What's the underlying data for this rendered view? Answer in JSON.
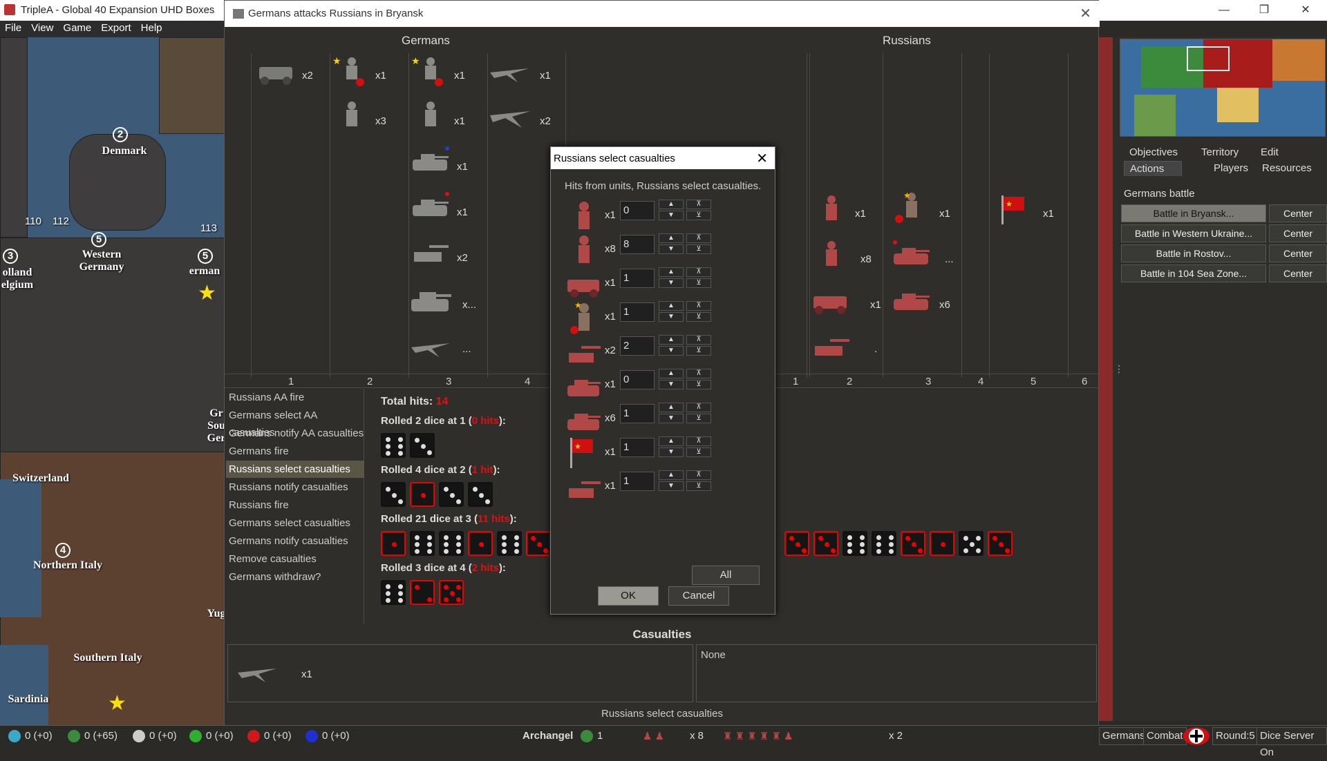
{
  "app": {
    "title": "TripleA - Global 40 Expansion UHD Boxes"
  },
  "menu": [
    {
      "label": "File"
    },
    {
      "label": "View"
    },
    {
      "label": "Game"
    },
    {
      "label": "Export"
    },
    {
      "label": "Help"
    }
  ],
  "map": {
    "labels": [
      {
        "text": "Denmark"
      },
      {
        "text": "Western Germany"
      },
      {
        "text": "olland elgium"
      },
      {
        "text": "erman"
      },
      {
        "text": "Switzerland"
      },
      {
        "text": "Northern Italy"
      },
      {
        "text": "Southern Italy"
      },
      {
        "text": "Sardinia"
      },
      {
        "text": "Gr Sou Ger"
      },
      {
        "text": "Yug"
      }
    ],
    "numbers": [
      "2",
      "5",
      "3",
      "5",
      "4",
      "110",
      "112",
      "113"
    ]
  },
  "battle": {
    "title": "Germans attacks Russians in Bryansk",
    "attacker": "Germans",
    "defender": "Russians",
    "attacker_columns": [
      "1",
      "2",
      "3",
      "4"
    ],
    "defender_columns": [
      "1",
      "2",
      "3",
      "4",
      "5",
      "6"
    ],
    "attacker_units": [
      {
        "col": 1,
        "type": "halftrack",
        "count": "x2"
      },
      {
        "col": 2,
        "type": "elite-infantry",
        "count": "x1"
      },
      {
        "col": 2,
        "type": "infantry",
        "count": "x3"
      },
      {
        "col": 3,
        "type": "elite-infantry",
        "count": "x1"
      },
      {
        "col": 3,
        "type": "infantry",
        "count": "x1"
      },
      {
        "col": 3,
        "type": "tank",
        "count": "x1"
      },
      {
        "col": 3,
        "type": "tank",
        "count": "x1"
      },
      {
        "col": 3,
        "type": "artillery",
        "count": "x2"
      },
      {
        "col": 3,
        "type": "heavy-tank",
        "count": "x..."
      },
      {
        "col": 3,
        "type": "fighter",
        "count": "..."
      },
      {
        "col": 4,
        "type": "fighter",
        "count": "x1"
      },
      {
        "col": 4,
        "type": "bomber",
        "count": "x2"
      }
    ],
    "defender_units": [
      {
        "col": 2,
        "type": "infantry",
        "count": "x1"
      },
      {
        "col": 2,
        "type": "infantry",
        "count": "x8"
      },
      {
        "col": 2,
        "type": "halftrack",
        "count": "x1"
      },
      {
        "col": 2,
        "type": "artillery",
        "count": "."
      },
      {
        "col": 3,
        "type": "elite-infantry",
        "count": "x1"
      },
      {
        "col": 3,
        "type": "tank",
        "count": "..."
      },
      {
        "col": 3,
        "type": "tank",
        "count": "x6"
      },
      {
        "col": 5,
        "type": "flag",
        "count": "x1"
      }
    ],
    "steps": [
      {
        "label": "Russians AA fire"
      },
      {
        "label": "Germans select AA casualties"
      },
      {
        "label": "Germans notify AA casualties"
      },
      {
        "label": "Germans fire"
      },
      {
        "label": "Russians select casualties"
      },
      {
        "label": "Russians notify casualties"
      },
      {
        "label": "Russians fire"
      },
      {
        "label": "Germans select casualties"
      },
      {
        "label": "Germans notify casualties"
      },
      {
        "label": "Remove casualties"
      },
      {
        "label": "Germans withdraw?"
      }
    ],
    "current_step": 4,
    "total_hits_label": "Total hits:",
    "total_hits": "14",
    "rolls": [
      {
        "prefix": "Rolled 2 dice at 1 (",
        "hits": "0 hits",
        "suffix": "):",
        "dice": [
          6,
          3
        ],
        "hit": [
          false,
          false
        ]
      },
      {
        "prefix": "Rolled 4 dice at 2 (",
        "hits": "1 hit",
        "suffix": "):",
        "dice": [
          3,
          1,
          3,
          3
        ],
        "hit": [
          false,
          true,
          false,
          false
        ]
      },
      {
        "prefix": "Rolled 21 dice at 3 (",
        "hits": "11 hits",
        "suffix": "):",
        "dice": [
          1,
          6,
          6,
          1,
          6,
          3,
          3,
          3,
          6,
          6,
          3,
          1,
          5,
          3
        ],
        "hit": [
          true,
          false,
          false,
          true,
          false,
          true,
          true,
          true,
          false,
          false,
          true,
          true,
          false,
          true
        ]
      },
      {
        "prefix": "Rolled 3 dice at 4 (",
        "hits": "2 hits",
        "suffix": "):",
        "dice": [
          6,
          2,
          5
        ],
        "hit": [
          false,
          true,
          true
        ]
      }
    ],
    "casualties_label": "Casualties",
    "casualty_attacker": {
      "type": "fighter",
      "count": "x1"
    },
    "casualty_defender": "None",
    "status": "Russians select  casualties"
  },
  "dialog": {
    "title": "Russians select casualties",
    "message": "Hits from units,  Russians select  casualties.",
    "rows": [
      {
        "type": "infantry",
        "count": "x1",
        "value": "0"
      },
      {
        "type": "infantry",
        "count": "x8",
        "value": "8"
      },
      {
        "type": "halftrack",
        "count": "x1",
        "value": "1"
      },
      {
        "type": "elite-infantry",
        "count": "x1",
        "value": "1"
      },
      {
        "type": "artillery",
        "count": "x2",
        "value": "2"
      },
      {
        "type": "tank",
        "count": "x1",
        "value": "0"
      },
      {
        "type": "tank",
        "count": "x6",
        "value": "1"
      },
      {
        "type": "flag",
        "count": "x1",
        "value": "1"
      },
      {
        "type": "artillery",
        "count": "x1",
        "value": "1"
      }
    ],
    "all_label": "All",
    "ok_label": "OK",
    "cancel_label": "Cancel"
  },
  "right_panel": {
    "tabs_row1": [
      "Objectives",
      "Territory",
      "Edit"
    ],
    "tabs_row2": [
      "Actions",
      "Players",
      "Resources"
    ],
    "section_title": "Germans battle",
    "battles": [
      {
        "label": "Battle in Bryansk...",
        "center": "Center"
      },
      {
        "label": "Battle in Western Ukraine...",
        "center": "Center"
      },
      {
        "label": "Battle in Rostov...",
        "center": "Center"
      },
      {
        "label": "Battle in 104 Sea Zone...",
        "center": "Center"
      }
    ]
  },
  "bottom_bar": {
    "resources": [
      {
        "value": "0 (+0)",
        "color": "#3aa8c8"
      },
      {
        "value": "0 (+65)",
        "color": "#3c8a3c"
      },
      {
        "value": "0 (+0)",
        "color": "#cccccc"
      },
      {
        "value": "0 (+0)",
        "color": "#2fae2f"
      },
      {
        "value": "0 (+0)",
        "color": "#d01818"
      },
      {
        "value": "0 (+0)",
        "color": "#2030d0"
      }
    ],
    "territory": "Archangel",
    "territory_value": "1",
    "unit_count_a": "x 8",
    "unit_count_b": "x 2",
    "player": "Germans",
    "phase": "Combat",
    "round": "Round:5",
    "dice_server": "Dice Server On"
  },
  "colors": {
    "hit_red": "#e01010",
    "selected_step": "#5a5645",
    "map_sea": "#3d5a78"
  }
}
